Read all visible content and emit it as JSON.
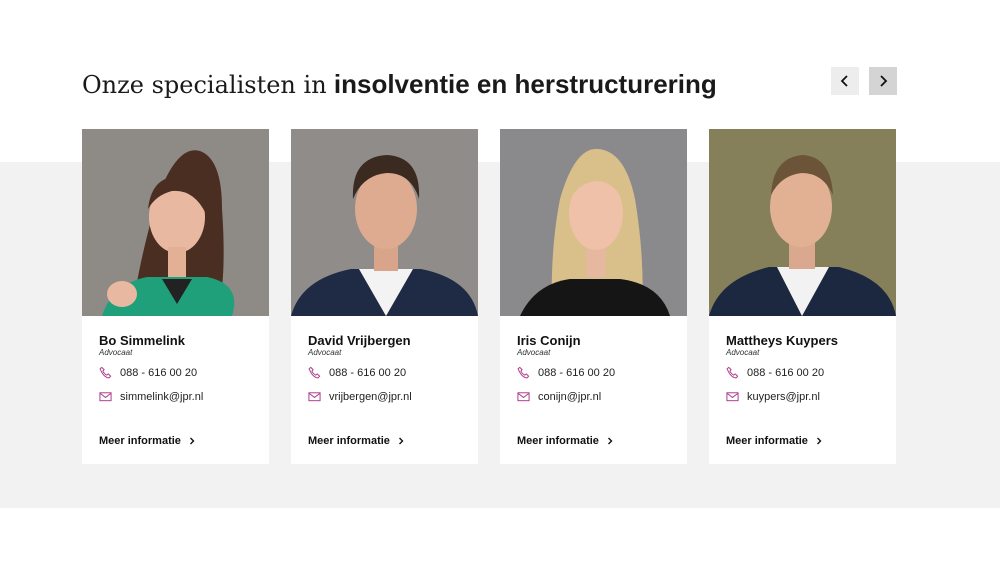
{
  "header": {
    "title_light": "Onze specialisten in",
    "title_bold": "insolventie en herstructurering",
    "prev_icon": "chevron-left-icon",
    "next_icon": "chevron-right-icon"
  },
  "colors": {
    "accent": "#b0428f",
    "band": "#f2f2f2",
    "text": "#111111"
  },
  "specialists": [
    {
      "name": "Bo Simmelink",
      "role": "Advocaat",
      "phone": "088 - 616 00 20",
      "email": "simmelink@jpr.nl",
      "more": "Meer informatie"
    },
    {
      "name": "David Vrijbergen",
      "role": "Advocaat",
      "phone": "088 - 616 00 20",
      "email": "vrijbergen@jpr.nl",
      "more": "Meer informatie"
    },
    {
      "name": "Iris Conijn",
      "role": "Advocaat",
      "phone": "088 - 616 00 20",
      "email": "conijn@jpr.nl",
      "more": "Meer informatie"
    },
    {
      "name": "Mattheys Kuypers",
      "role": "Advocaat",
      "phone": "088 - 616 00 20",
      "email": "kuypers@jpr.nl",
      "more": "Meer informatie"
    }
  ]
}
